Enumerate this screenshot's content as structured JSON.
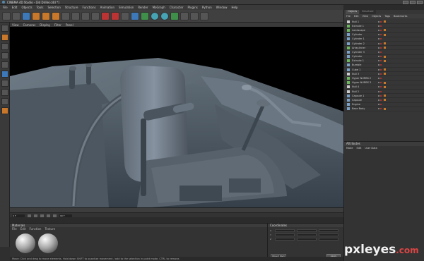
{
  "app": {
    "title": "CINEMA 4D Studio - [3d Driller.c4d *]"
  },
  "menubar": [
    "File",
    "Edit",
    "Objects",
    "Tools",
    "Selection",
    "Structure",
    "Functions",
    "Animation",
    "Simulation",
    "Render",
    "MoGraph",
    "Character",
    "Plugins",
    "Python",
    "Window",
    "Help"
  ],
  "viewport_menu": [
    "View",
    "Cameras",
    "Display",
    "Filter",
    "Panel"
  ],
  "object_manager": {
    "tabs": [
      "Objects",
      "Structure"
    ],
    "menu": [
      "File",
      "Edit",
      "View",
      "Objects",
      "Tags",
      "Bookmarks"
    ],
    "objects": [
      {
        "name": "Null 1",
        "icon": "null"
      },
      {
        "name": "Extrude 1",
        "icon": "generator"
      },
      {
        "name": "Landscape",
        "icon": "generator"
      },
      {
        "name": "Cylinder",
        "icon": "primitive"
      },
      {
        "name": "Cylinder 1",
        "icon": "primitive"
      },
      {
        "name": "Cylinder 2",
        "icon": "primitive"
      },
      {
        "name": "Array.Inner",
        "icon": "generator"
      },
      {
        "name": "Cylinder 3",
        "icon": "primitive"
      },
      {
        "name": "Cylinder",
        "icon": "primitive"
      },
      {
        "name": "Extrude 1",
        "icon": "generator"
      },
      {
        "name": "Bumble",
        "icon": "primitive"
      },
      {
        "name": "Cube 1",
        "icon": "primitive"
      },
      {
        "name": "Null 3",
        "icon": "null"
      },
      {
        "name": "Hyper NURBS 2",
        "icon": "generator"
      },
      {
        "name": "Hyper NURBS 3",
        "icon": "generator"
      },
      {
        "name": "Null 4",
        "icon": "null"
      },
      {
        "name": "Null 2",
        "icon": "null"
      },
      {
        "name": "Capsule 1",
        "icon": "primitive"
      },
      {
        "name": "Capsule",
        "icon": "primitive"
      },
      {
        "name": "Engine",
        "icon": "primitive"
      },
      {
        "name": "Base Body",
        "icon": "primitive"
      }
    ]
  },
  "attributes": {
    "title": "Attributes",
    "menu": [
      "Mode",
      "Edit",
      "User Data"
    ]
  },
  "materials": {
    "title": "Materials",
    "menu": [
      "File",
      "Edit",
      "Function",
      "Texture"
    ]
  },
  "coordinates": {
    "title": "Coordinates",
    "rows": [
      "X",
      "Y",
      "Z"
    ],
    "select_label": "Object (Rel)",
    "apply_label": "Apply"
  },
  "timeline": {
    "frame_start": "0 F",
    "frame_end": "90 F"
  },
  "status": "Move: Click and drag to move elements. Hold down SHIFT to quantize movement / add to the selection in point mode, CTRL to remove.",
  "watermark": {
    "main": "pxleyes",
    "domain": ".com"
  }
}
